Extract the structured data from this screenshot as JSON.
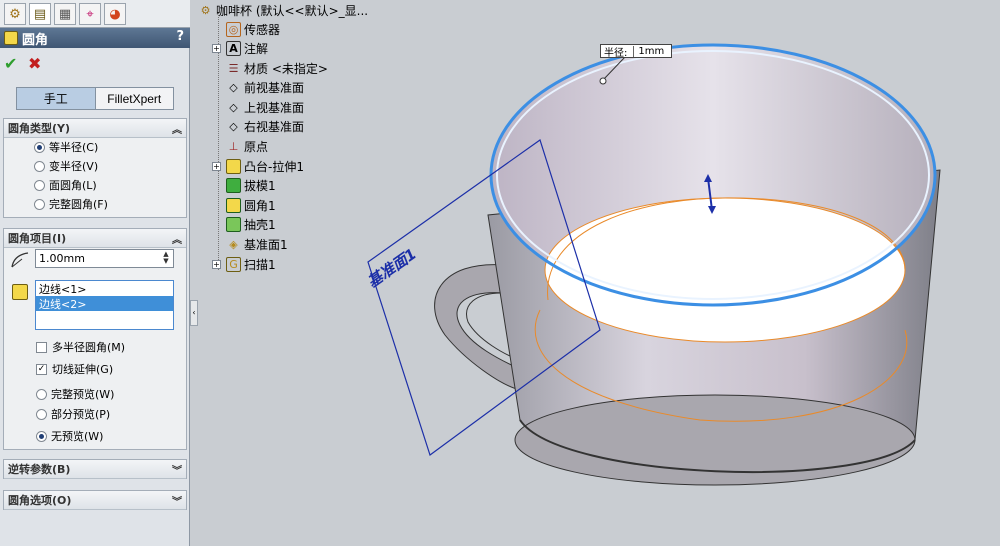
{
  "property_manager": {
    "title": "圆角",
    "help": "?",
    "ok_glyph": "✔",
    "cancel_glyph": "✖",
    "modes": [
      "手工",
      "FilletXpert"
    ],
    "fillet_type": {
      "header": "圆角类型(Y)",
      "options": [
        "等半径(C)",
        "变半径(V)",
        "面圆角(L)",
        "完整圆角(F)"
      ],
      "selected_index": 0
    },
    "fillet_items": {
      "header": "圆角项目(I)",
      "radius_value": "1.00mm",
      "edges": [
        "边线<1>",
        "边线<2>"
      ],
      "selected_edge_index": 1,
      "multi_radius_label": "多半径圆角(M)",
      "multi_radius_checked": false,
      "tangent_label": "切线延伸(G)",
      "tangent_checked": true,
      "preview_options": [
        "完整预览(W)",
        "部分预览(P)",
        "无预览(W)"
      ],
      "preview_selected_index": 2
    },
    "setback_header": "逆转参数(B)",
    "options_header": "圆角选项(O)"
  },
  "feature_tree": {
    "root": "咖啡杯 (默认<<默认>_显...",
    "items": [
      {
        "label": "传感器",
        "expandable": false,
        "icon": "sensor-icon"
      },
      {
        "label": "注解",
        "expandable": true,
        "icon": "annotation-icon"
      },
      {
        "label": "材质 <未指定>",
        "expandable": false,
        "icon": "material-icon"
      },
      {
        "label": "前视基准面",
        "expandable": false,
        "icon": "plane-icon"
      },
      {
        "label": "上视基准面",
        "expandable": false,
        "icon": "plane-icon"
      },
      {
        "label": "右视基准面",
        "expandable": false,
        "icon": "plane-icon"
      },
      {
        "label": "原点",
        "expandable": false,
        "icon": "origin-icon"
      },
      {
        "label": "凸台-拉伸1",
        "expandable": true,
        "icon": "extrude-icon"
      },
      {
        "label": "拔模1",
        "expandable": false,
        "icon": "draft-icon"
      },
      {
        "label": "圆角1",
        "expandable": false,
        "icon": "fillet-icon"
      },
      {
        "label": "抽壳1",
        "expandable": false,
        "icon": "shell-icon"
      },
      {
        "label": "基准面1",
        "expandable": false,
        "icon": "plane-icon"
      },
      {
        "label": "扫描1",
        "expandable": true,
        "icon": "sweep-icon"
      }
    ]
  },
  "viewport": {
    "radius_callout_label": "半径:",
    "radius_callout_value": "1mm",
    "plane_label": "基准面1"
  }
}
